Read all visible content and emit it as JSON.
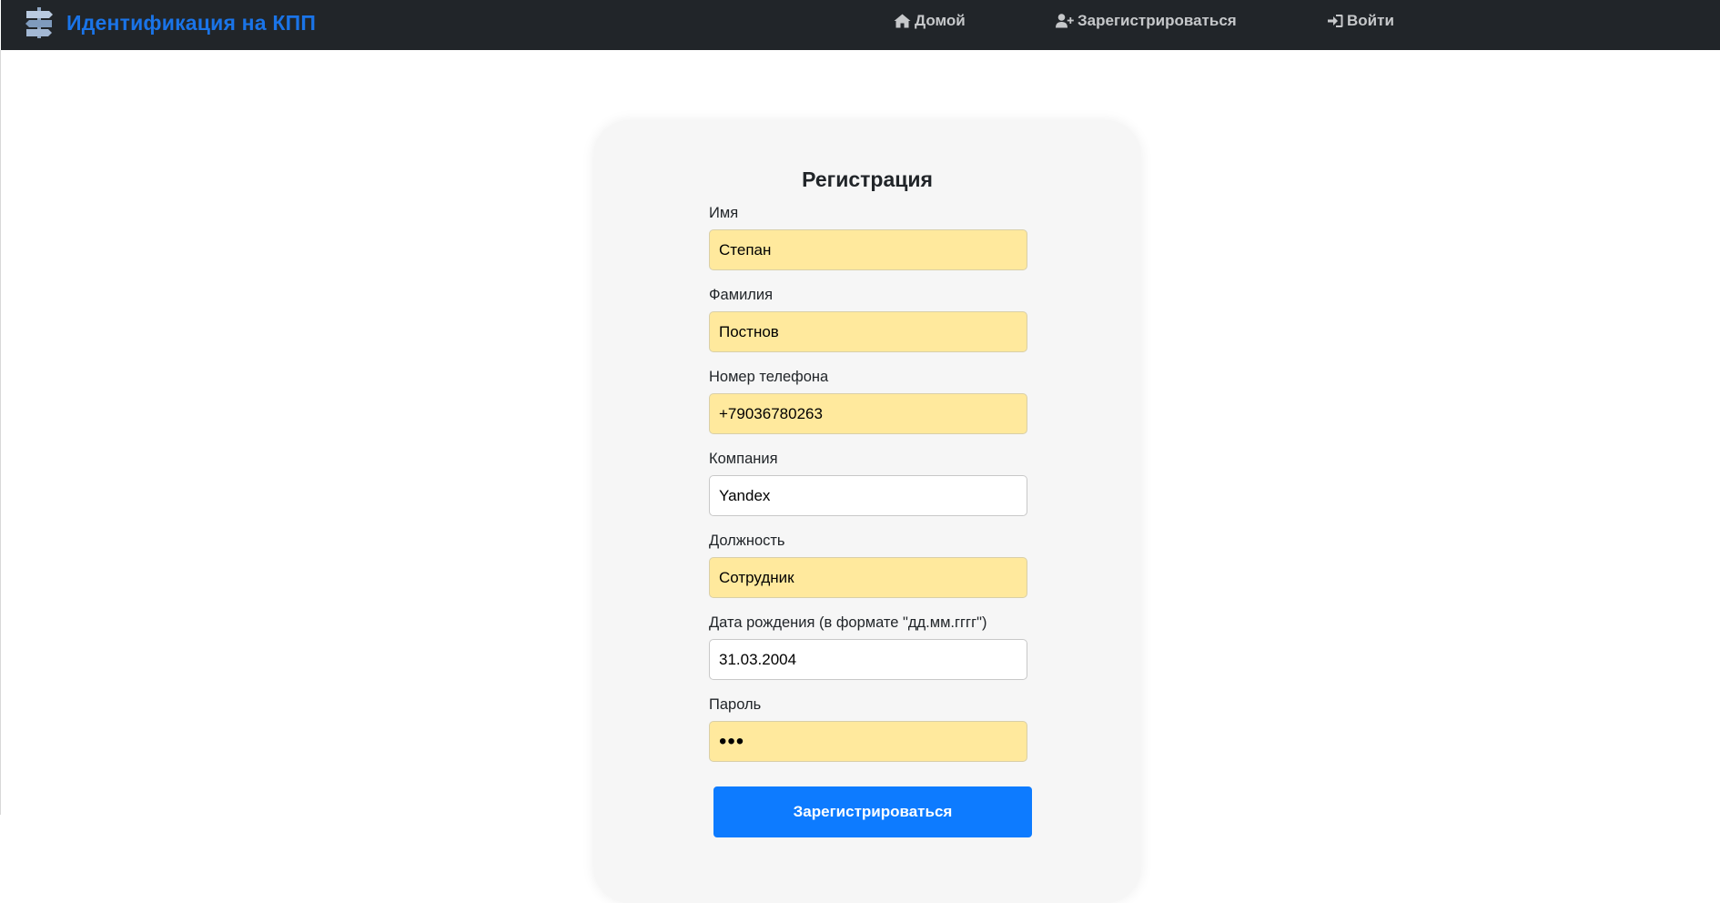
{
  "navbar": {
    "brand_title": "Идентификация на КПП",
    "links": [
      {
        "icon": "home-icon",
        "label": "Домой"
      },
      {
        "icon": "user-plus-icon",
        "label": "Зарегистрироваться"
      },
      {
        "icon": "sign-in-icon",
        "label": "Войти"
      }
    ]
  },
  "form": {
    "title": "Регистрация",
    "fields": [
      {
        "label": "Имя",
        "value": "Степан",
        "autofilled": true
      },
      {
        "label": "Фамилия",
        "value": "Постнов",
        "autofilled": true
      },
      {
        "label": "Номер телефона",
        "value": "+79036780263",
        "autofilled": true
      },
      {
        "label": "Компания",
        "value": "Yandex",
        "autofilled": false
      },
      {
        "label": "Должность",
        "value": "Сотрудник",
        "autofilled": true
      },
      {
        "label": "Дата рождения (в формате \"дд.мм.гггг\")",
        "value": "31.03.2004",
        "autofilled": false
      },
      {
        "label": "Пароль",
        "value": "•••",
        "autofilled": true
      }
    ],
    "submit_label": "Зарегистрироваться"
  },
  "colors": {
    "navbar_bg": "#212529",
    "brand": "#1a74e8",
    "nav_link": "#c6c8ca",
    "autofill_bg": "#ffe99d",
    "primary_button": "#0d7bff",
    "card_bg": "#f6f6f6"
  }
}
